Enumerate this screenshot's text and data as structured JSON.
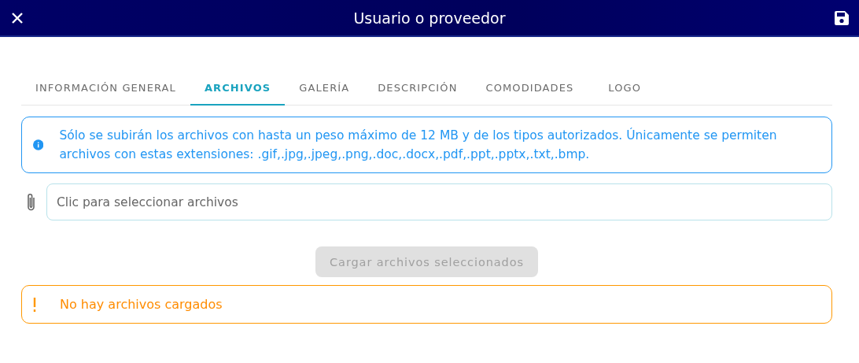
{
  "window": {
    "title": "Usuario o proveedor"
  },
  "tabs": [
    {
      "label": "INFORMACIÓN GENERAL",
      "selected": false
    },
    {
      "label": "ARCHIVOS",
      "selected": true
    },
    {
      "label": "GALERÍA",
      "selected": false
    },
    {
      "label": "DESCRIPCIÓN",
      "selected": false
    },
    {
      "label": "COMODIDADES",
      "selected": false
    },
    {
      "label": "LOGO",
      "selected": false
    }
  ],
  "info_alert": {
    "text": "Sólo se subirán los archivos con hasta un peso máximo de 12 MB y de los tipos autorizados. Únicamente se permiten archivos con estas extensiones: .gif,.jpg,.jpeg,.png,.doc,.docx,.pdf,.ppt,.pptx,.txt,.bmp."
  },
  "file_field": {
    "placeholder": "Clic para seleccionar archivos"
  },
  "upload_button": {
    "label": "Cargar archivos seleccionados",
    "disabled": true
  },
  "warning_alert": {
    "text": "No hay archivos cargados"
  }
}
